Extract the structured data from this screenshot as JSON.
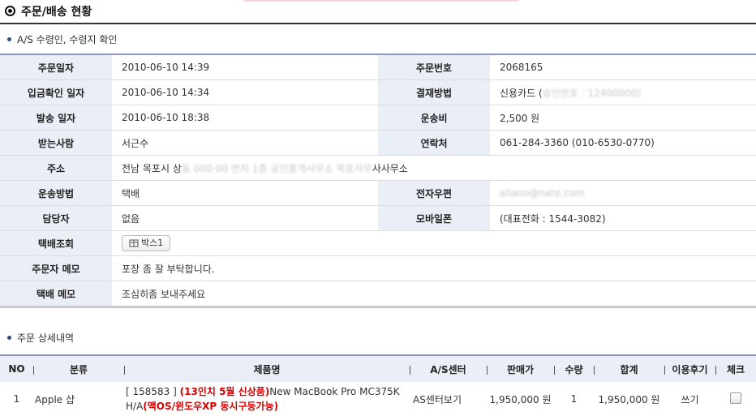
{
  "page": {
    "title": "주문/배송 현황"
  },
  "section_as": {
    "title": "A/S 수령인, 수령지 확인"
  },
  "info": {
    "order_date_label": "주문일자",
    "order_date": "2010-06-10 14:39",
    "order_no_label": "주문번호",
    "order_no": "2068165",
    "deposit_label": "입금확인 일자",
    "deposit_date": "2010-06-10 14:34",
    "payment_label": "결재방법",
    "payment_method": "신용카드 (",
    "ship_date_label": "발송 일자",
    "ship_date": "2010-06-10 18:38",
    "ship_fee_label": "운송비",
    "ship_fee": "2,500 원",
    "recipient_label": "받는사람",
    "recipient": "서근수",
    "contact_label": "연락처",
    "contact": "061-284-3360 (010-6530-0770)",
    "address_label": "주소",
    "address_prefix": "전남 목포시 상",
    "address_suffix": "사사무소",
    "method_label": "운송방법",
    "method": "택배",
    "email_label": "전자우편",
    "manager_label": "담당자",
    "manager": "없음",
    "mobile_label": "모바일폰",
    "mobile": "(대표전화 : 1544-3082)",
    "tracking_label": "택배조회",
    "tracking_button": "박스1",
    "orderer_memo_label": "주문자 메모",
    "orderer_memo": "포장 좀 잘 부탁합니다.",
    "courier_memo_label": "택배 메모",
    "courier_memo": "조심히좀 보내주세요"
  },
  "section_detail": {
    "title": "주문 상세내역"
  },
  "orders": {
    "columns": [
      "NO",
      "분류",
      "제품명",
      "A/S센터",
      "판매가",
      "수량",
      "합계",
      "이용후기",
      "체크"
    ],
    "rows": [
      {
        "no": "1",
        "category": "Apple 샵",
        "code": "[ 158583 ]",
        "promo1": "(13인치 5월 신상품)",
        "name1": "New MacBook Pro MC375K",
        "name2": "H/A",
        "promo2": "(맥OS/윈도우XP 동시구동가능)",
        "as_center": "AS센터보기",
        "price": "1,950,000 원",
        "qty": "1",
        "total": "1,950,000 원",
        "review": "쓰기"
      }
    ]
  }
}
